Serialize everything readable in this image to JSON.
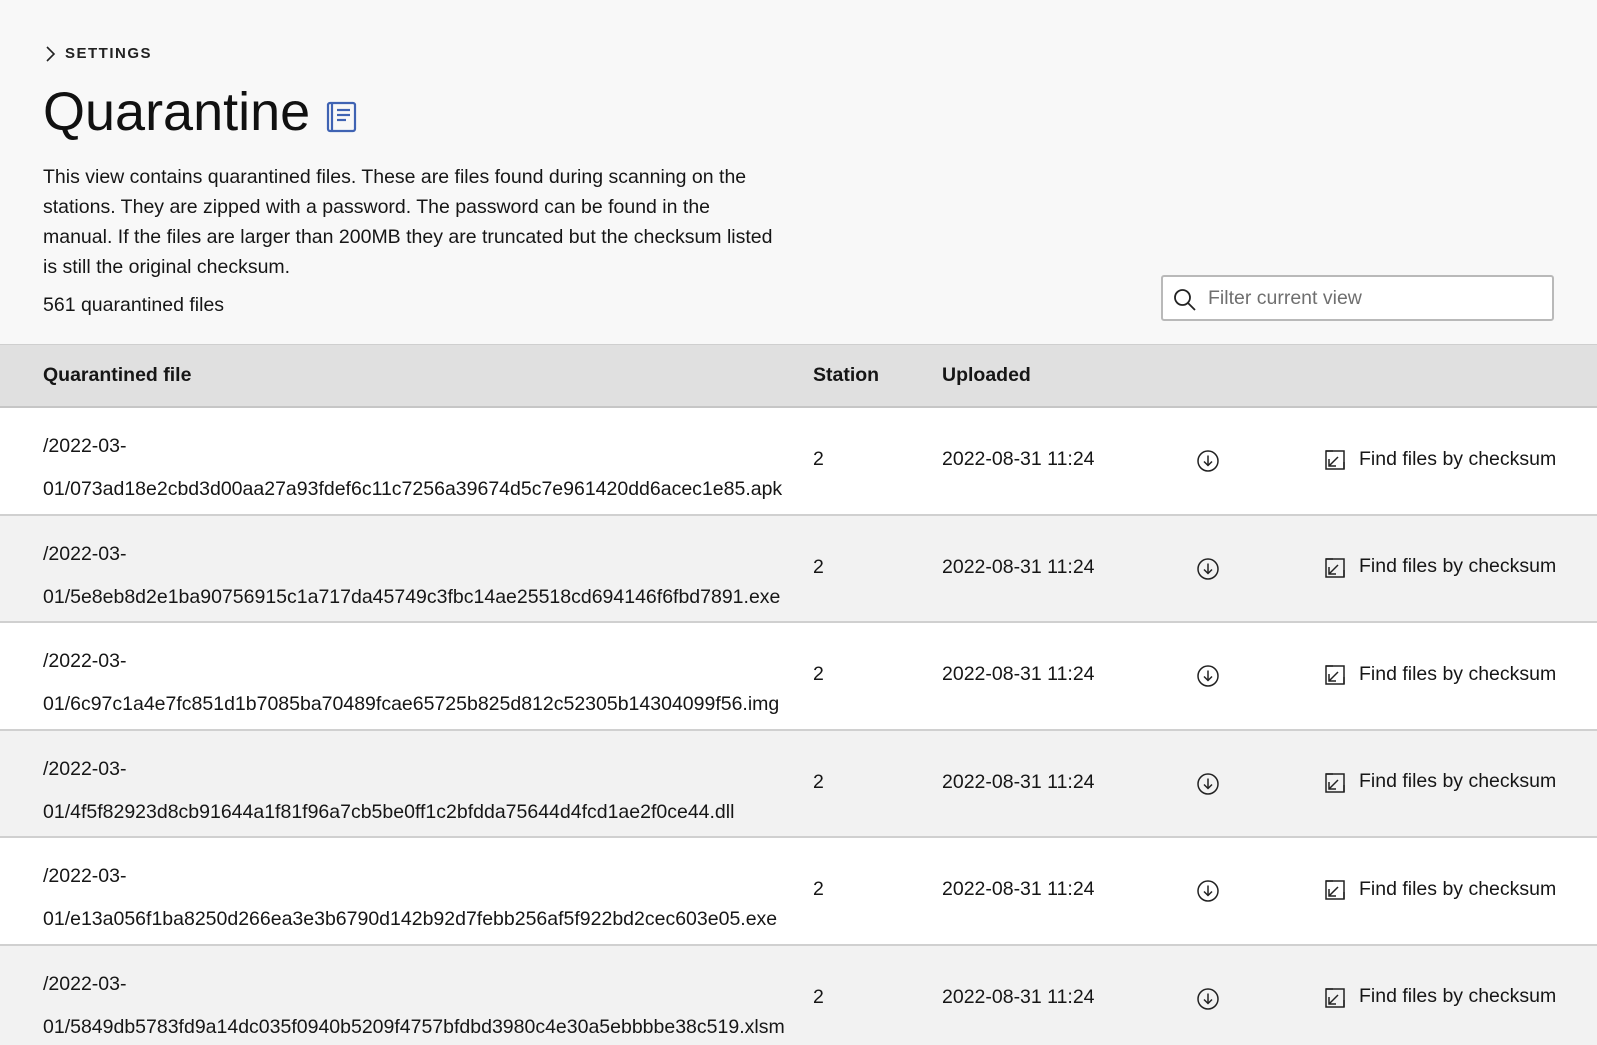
{
  "breadcrumb": {
    "label": "SETTINGS"
  },
  "page": {
    "title": "Quarantine",
    "description": "This view contains quarantined files. These are files found during scanning on the stations. They are zipped with a password. The password can be found in the manual. If the files are larger than 200MB they are truncated but the checksum listed is still the original checksum.",
    "count": "561 quarantined files"
  },
  "filter": {
    "placeholder": "Filter current view",
    "value": ""
  },
  "table": {
    "headers": {
      "file": "Quarantined file",
      "station": "Station",
      "uploaded": "Uploaded"
    },
    "action_label": "Find files by checksum",
    "rows": [
      {
        "path_line1": "/2022-03-",
        "path_line2": "01/073ad18e2cbd3d00aa27a93fdef6c11c7256a39674d5c7e961420dd6acec1e85.apk",
        "station": "2",
        "uploaded": "2022-08-31 11:24"
      },
      {
        "path_line1": "/2022-03-",
        "path_line2": "01/5e8eb8d2e1ba90756915c1a717da45749c3fbc14ae25518cd694146f6fbd7891.exe",
        "station": "2",
        "uploaded": "2022-08-31 11:24"
      },
      {
        "path_line1": "/2022-03-",
        "path_line2": "01/6c97c1a4e7fc851d1b7085ba70489fcae65725b825d812c52305b14304099f56.img",
        "station": "2",
        "uploaded": "2022-08-31 11:24"
      },
      {
        "path_line1": "/2022-03-",
        "path_line2": "01/4f5f82923d8cb91644a1f81f96a7cb5be0ff1c2bfdda75644d4fcd1ae2f0ce44.dll",
        "station": "2",
        "uploaded": "2022-08-31 11:24"
      },
      {
        "path_line1": "/2022-03-",
        "path_line2": "01/e13a056f1ba8250d266ea3e3b6790d142b92d7febb256af5f922bd2cec603e05.exe",
        "station": "2",
        "uploaded": "2022-08-31 11:24"
      },
      {
        "path_line1": "/2022-03-",
        "path_line2": "01/5849db5783fd9a14dc035f0940b5209f4757bfdbd3980c4e30a5ebbbbe38c519.xlsm",
        "station": "2",
        "uploaded": "2022-08-31 11:24"
      }
    ]
  },
  "icons": {
    "breadcrumb": "chevron-right-icon",
    "manual": "manual-book-icon",
    "search": "search-icon",
    "download": "download-icon",
    "launch": "launch-icon"
  },
  "colors": {
    "accent": "#3f63b3",
    "header_bg": "#e0e0e0",
    "row_alt": "#f2f2f2"
  }
}
